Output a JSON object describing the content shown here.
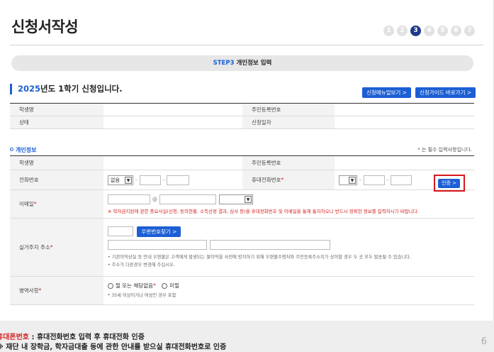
{
  "page_title": "신청서작성",
  "steps": [
    "1",
    "2",
    "3",
    "4",
    "5",
    "6",
    "7"
  ],
  "active_step": "3",
  "step_bar": {
    "step": "STEP3",
    "label": "개인정보 입력"
  },
  "semester": {
    "year": "2025",
    "text": "년도 1학기 신청입니다."
  },
  "buttons": {
    "manual": "신청매뉴얼보기 >",
    "guide": "신청가이드 바로가기 >",
    "zip_search": "우편번호찾기 >",
    "verify": "인증 >"
  },
  "top_table": {
    "student_name": "학생명",
    "resident_no": "주민등록번호",
    "status": "상태",
    "apply_date": "신청일자"
  },
  "personal": {
    "section_label": "개인정보",
    "required_note": "* 는 필수 입력사항입니다.",
    "student_name": "학생명",
    "resident_no": "주민등록번호",
    "phone": "전화번호",
    "phone_select": "없음",
    "mobile": "휴대전화번호",
    "email": "이메일",
    "email_hint": "※ 학자금지원에 관한 중요사실(신청, 동의현황, 소득산정 결과, 심사 등)을 휴대전화번호 및 이메일을 통해 통지하오니 반드시 정확한 정보를 입력하시기 바랍니다.",
    "address": "실거주지 주소",
    "address_hint1": "• 기관이익상실 등 안내 우편물은 고객에게 발생되는 불이익을 사전에 방지하기 위해 우편물수령처와 주민등록주소지가 상이할 경우 두 곳 모두 발송될 수 있습니다.",
    "address_hint2": "• 주소가 다른경우 변경해 주십시오.",
    "military": "병역사항",
    "military_opt1": "필 또는 해당없음",
    "military_opt2": "미필",
    "military_hint": "* 35세 이상이거나 여성인 경우 포함"
  },
  "footer": {
    "line1_red": "휴대폰번호",
    "line1_rest": " : 휴대전화번호 입력 후 휴대전화 인증",
    "line2": "※ 재단 내 장학금, 학자금대출 등에 관한 안내를 받으실 휴대전화번호로 인증",
    "page_number": "6"
  },
  "colors": {
    "accent": "#1c5fd4",
    "highlight": "#d8161d",
    "active_step": "#1d3a8a"
  }
}
